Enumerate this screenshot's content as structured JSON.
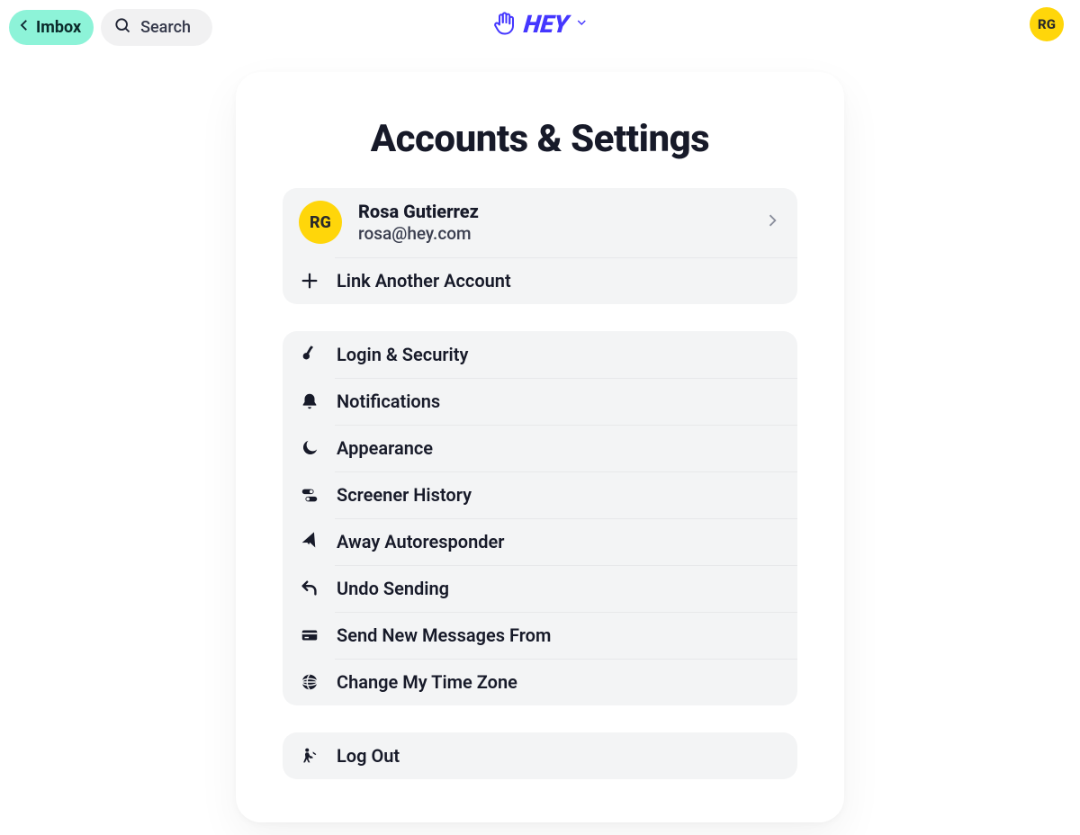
{
  "header": {
    "back_label": "Imbox",
    "search_placeholder": "Search",
    "logo_text": "HEY",
    "avatar_initials": "RG"
  },
  "page": {
    "title": "Accounts & Settings"
  },
  "account": {
    "initials": "RG",
    "name": "Rosa Gutierrez",
    "email": "rosa@hey.com",
    "link_another_label": "Link Another Account"
  },
  "settings": [
    {
      "id": "login-security",
      "label": "Login & Security",
      "icon": "key-icon"
    },
    {
      "id": "notifications",
      "label": "Notifications",
      "icon": "bell-icon"
    },
    {
      "id": "appearance",
      "label": "Appearance",
      "icon": "moon-icon"
    },
    {
      "id": "screener-history",
      "label": "Screener History",
      "icon": "toggles-icon"
    },
    {
      "id": "away-autoresponder",
      "label": "Away Autoresponder",
      "icon": "plane-icon"
    },
    {
      "id": "undo-sending",
      "label": "Undo Sending",
      "icon": "undo-icon"
    },
    {
      "id": "send-from",
      "label": "Send New Messages From",
      "icon": "card-icon"
    },
    {
      "id": "time-zone",
      "label": "Change My Time Zone",
      "icon": "globe-icon"
    }
  ],
  "logout": {
    "label": "Log Out",
    "icon": "exit-icon"
  },
  "colors": {
    "accent": "#4537ff",
    "mint": "#8df3d8",
    "yellow": "#ffd60a"
  }
}
